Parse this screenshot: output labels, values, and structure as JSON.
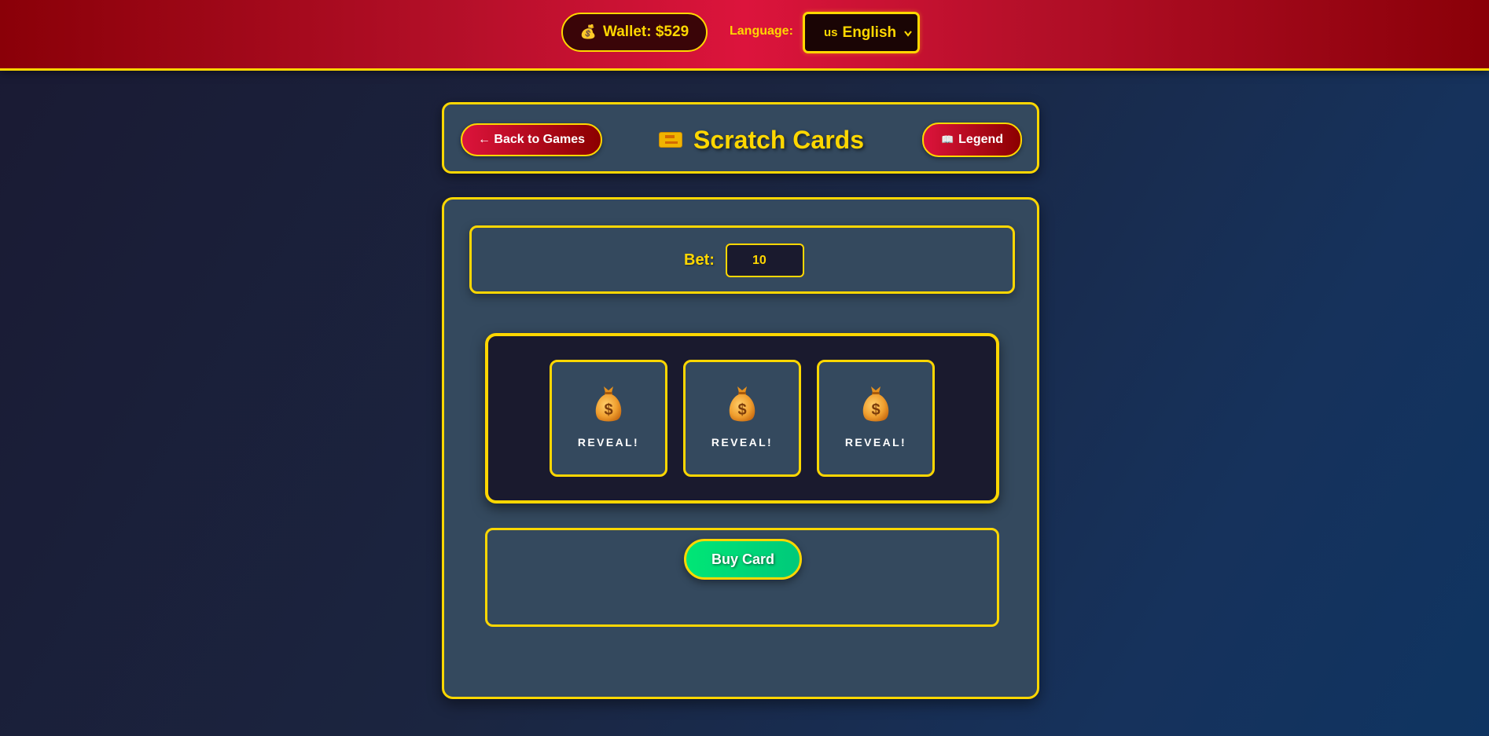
{
  "topbar": {
    "wallet": {
      "icon": "money-bag-icon",
      "label": "Wallet: $529"
    },
    "language": {
      "label": "Language:",
      "selected_flag": "us",
      "selected": "English"
    }
  },
  "header": {
    "back_label": "← Back to Games",
    "title_icon": "ticket-icon",
    "title": "Scratch Cards",
    "legend_icon": "book-icon",
    "legend_label": "Legend"
  },
  "bet": {
    "label": "Bet:",
    "value": "10"
  },
  "cards": [
    {
      "icon": "money-bag-icon",
      "label": "REVEAL!"
    },
    {
      "icon": "money-bag-icon",
      "label": "REVEAL!"
    },
    {
      "icon": "money-bag-icon",
      "label": "REVEAL!"
    }
  ],
  "actions": {
    "buy_label": "Buy Card"
  },
  "colors": {
    "accent": "#ffd700",
    "topbar": "#dc143c",
    "panel": "#34495e",
    "card_area": "#1a1a2e",
    "buy_button": "#00e676"
  }
}
